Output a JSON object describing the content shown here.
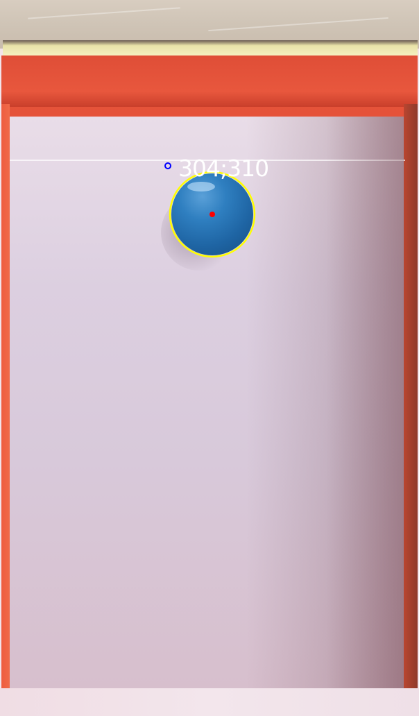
{
  "scene": {
    "description_objects": [
      "blue-ball",
      "red-box",
      "paper-floor"
    ]
  },
  "tracking_overlay": {
    "coordinate_label": "304;310",
    "detection_circle_color": "#ffff00",
    "center_dot_color": "#ff0000",
    "reference_marker_color": "#0000ff",
    "label_color": "#ffffff"
  }
}
